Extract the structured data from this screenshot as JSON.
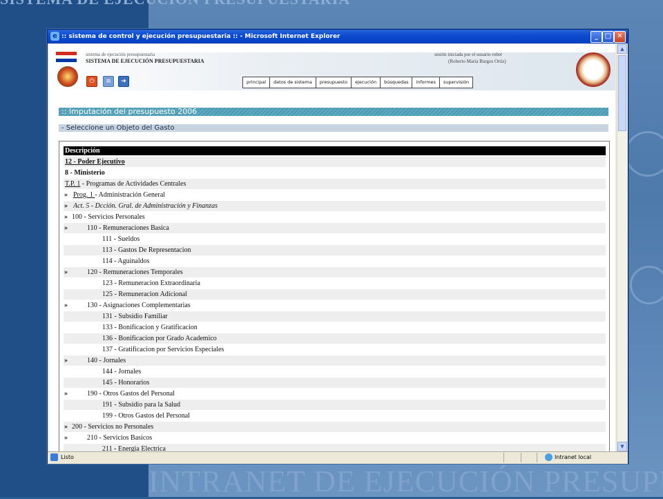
{
  "slide": {
    "top_text": "SISTEMA DE EJECUCIÓN PRESUPUESTARIA",
    "bottom_text": "INTRANET DE EJECUCIÓN PRESUPUESTARIA",
    "colors": {
      "left_panel": "#1f4f86",
      "right_panel": "#5c86b5"
    }
  },
  "window": {
    "title": ":: sistema de control y ejecución presupuestaria :: - Microsoft Internet Explorer",
    "buttons": {
      "minimize": "_",
      "maximize": "□",
      "close": "✕"
    }
  },
  "header": {
    "system_small": "sistema de ejecución presupuestaria",
    "system_title": "SISTEMA DE EJECUCIÓN PRESUPUESTARIA",
    "session_line": "sesión iniciada por el usuario rober",
    "session_user": "(Roberto María Burgos Ortiz)",
    "tool_icons": [
      "power-icon",
      "document-icon",
      "logout-icon"
    ],
    "menu": [
      "principal",
      "datos de sistema",
      "presupuesto",
      "ejecución",
      "búsquedas",
      "informes",
      "supervisión"
    ]
  },
  "page": {
    "section_title": ":: Imputación del presupuesto 2006",
    "sub_title": "- Seleccione un Objeto del Gasto"
  },
  "table": {
    "header": "Descripción",
    "rows": [
      {
        "arrow": "",
        "indent": 0,
        "text": "12 - Poder Ejecutivo",
        "style": "bu"
      },
      {
        "arrow": "",
        "indent": 0,
        "text": "8 - Ministerio",
        "style": "b"
      },
      {
        "arrow": "",
        "indent": 0,
        "prefix": "T.P. 1",
        "text": " - Programas de Actividades Centrales",
        "style": ""
      },
      {
        "arrow": "»",
        "indent": 1,
        "prefix": "Prog. 1 ",
        "text": "- Administración General",
        "style": ""
      },
      {
        "arrow": "»",
        "indent": 1,
        "text": "Act. 5 - Dcción. Gral. de Administración y Finanzas",
        "style": "i"
      },
      {
        "arrow": "»",
        "indent": 0.5,
        "text": "100 - Servicios Personales",
        "style": ""
      },
      {
        "arrow": "»",
        "indent": 2,
        "text": "110 - Remuneraciones Basica",
        "style": ""
      },
      {
        "arrow": "",
        "indent": 3,
        "text": "111 - Sueldos",
        "style": ""
      },
      {
        "arrow": "",
        "indent": 3,
        "text": "113 - Gastos De Representacion",
        "style": ""
      },
      {
        "arrow": "",
        "indent": 3,
        "text": "114 - Aguinaldos",
        "style": ""
      },
      {
        "arrow": "»",
        "indent": 2,
        "text": "120 - Remuneraciones Temporales",
        "style": ""
      },
      {
        "arrow": "",
        "indent": 3,
        "text": "123 - Remuneracion Extraordinaria",
        "style": ""
      },
      {
        "arrow": "",
        "indent": 3,
        "text": "125 - Remuneracion Adicional",
        "style": ""
      },
      {
        "arrow": "»",
        "indent": 2,
        "text": "130 - Asignaciones Complementarias",
        "style": ""
      },
      {
        "arrow": "",
        "indent": 3,
        "text": "131 - Subsidio Familiar",
        "style": ""
      },
      {
        "arrow": "",
        "indent": 3,
        "text": "133 - Bonificacion y Gratificacion",
        "style": ""
      },
      {
        "arrow": "",
        "indent": 3,
        "text": "136 - Bonificacion por Grado Academico",
        "style": ""
      },
      {
        "arrow": "",
        "indent": 3,
        "text": "137 - Gratificacion por Servicios Especiales",
        "style": ""
      },
      {
        "arrow": "»",
        "indent": 2,
        "text": "140 - Jornales",
        "style": ""
      },
      {
        "arrow": "",
        "indent": 3,
        "text": "144 - Jornales",
        "style": ""
      },
      {
        "arrow": "",
        "indent": 3,
        "text": "145 - Honorarios",
        "style": ""
      },
      {
        "arrow": "»",
        "indent": 2,
        "text": "190 - Otros Gastos del Personal",
        "style": ""
      },
      {
        "arrow": "",
        "indent": 3,
        "text": "191 - Subsidio para la Salud",
        "style": ""
      },
      {
        "arrow": "",
        "indent": 3,
        "text": "199 - Otros Gastos del Personal",
        "style": ""
      },
      {
        "arrow": "»",
        "indent": 0.5,
        "text": "200 - Servicios no Personales",
        "style": ""
      },
      {
        "arrow": "»",
        "indent": 2,
        "text": "210 - Servicios Basicos",
        "style": ""
      },
      {
        "arrow": "",
        "indent": 3,
        "text": "211 - Energia Electrica",
        "style": ""
      }
    ]
  },
  "status": {
    "left": "Listo",
    "zone": "Intranet local"
  }
}
